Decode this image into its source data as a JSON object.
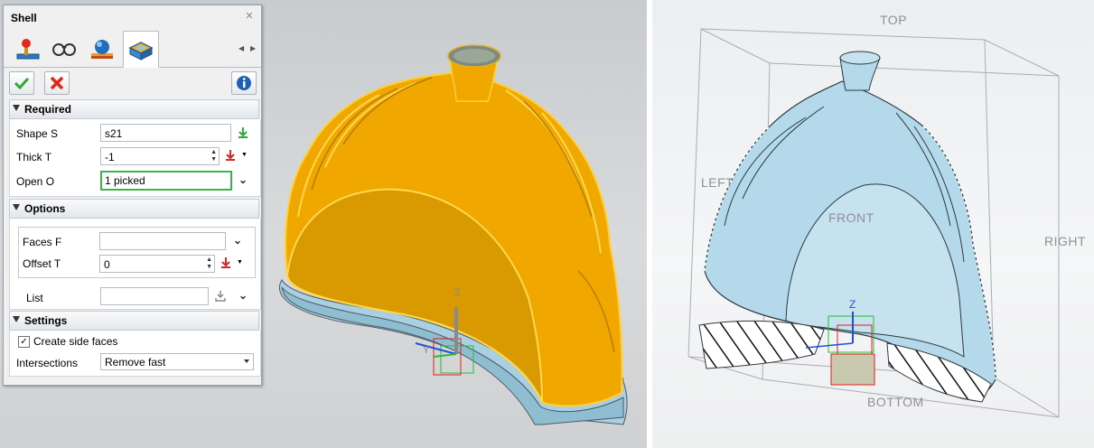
{
  "panel": {
    "title": "Shell",
    "close_icon": "close-icon",
    "tabs": [
      {
        "icon": "joystick-icon"
      },
      {
        "icon": "glasses-icon"
      },
      {
        "icon": "sphere-icon"
      },
      {
        "icon": "shell-box-icon",
        "active": true
      }
    ],
    "toolbar": {
      "ok_icon": "checkmark-icon",
      "cancel_icon": "cross-icon",
      "info_icon": "info-icon"
    },
    "required": {
      "header": "Required",
      "shape_label": "Shape S",
      "shape_value": "s21",
      "thick_label": "Thick T",
      "thick_value": "-1",
      "open_label": "Open O",
      "open_value": "1 picked"
    },
    "options": {
      "header": "Options",
      "faces_label": "Faces F",
      "faces_value": "",
      "offset_label": "Offset T",
      "offset_value": "0",
      "list_label": "List",
      "list_value": ""
    },
    "settings": {
      "header": "Settings",
      "side_faces_label": "Create side faces",
      "side_faces_checked": true,
      "intersections_label": "Intersections",
      "intersections_value": "Remove fast"
    }
  },
  "viewport_left": {
    "axis_z": "Z",
    "axis_y": "Y",
    "model_color": "#f0a800",
    "base_color": "#a9cfe0"
  },
  "viewport_right": {
    "labels": {
      "top": "TOP",
      "left": "LEFT",
      "front": "FRONT",
      "right": "RIGHT",
      "bottom": "BOTTOM"
    },
    "axis_z": "Z",
    "model_color": "#b3d9ea"
  }
}
